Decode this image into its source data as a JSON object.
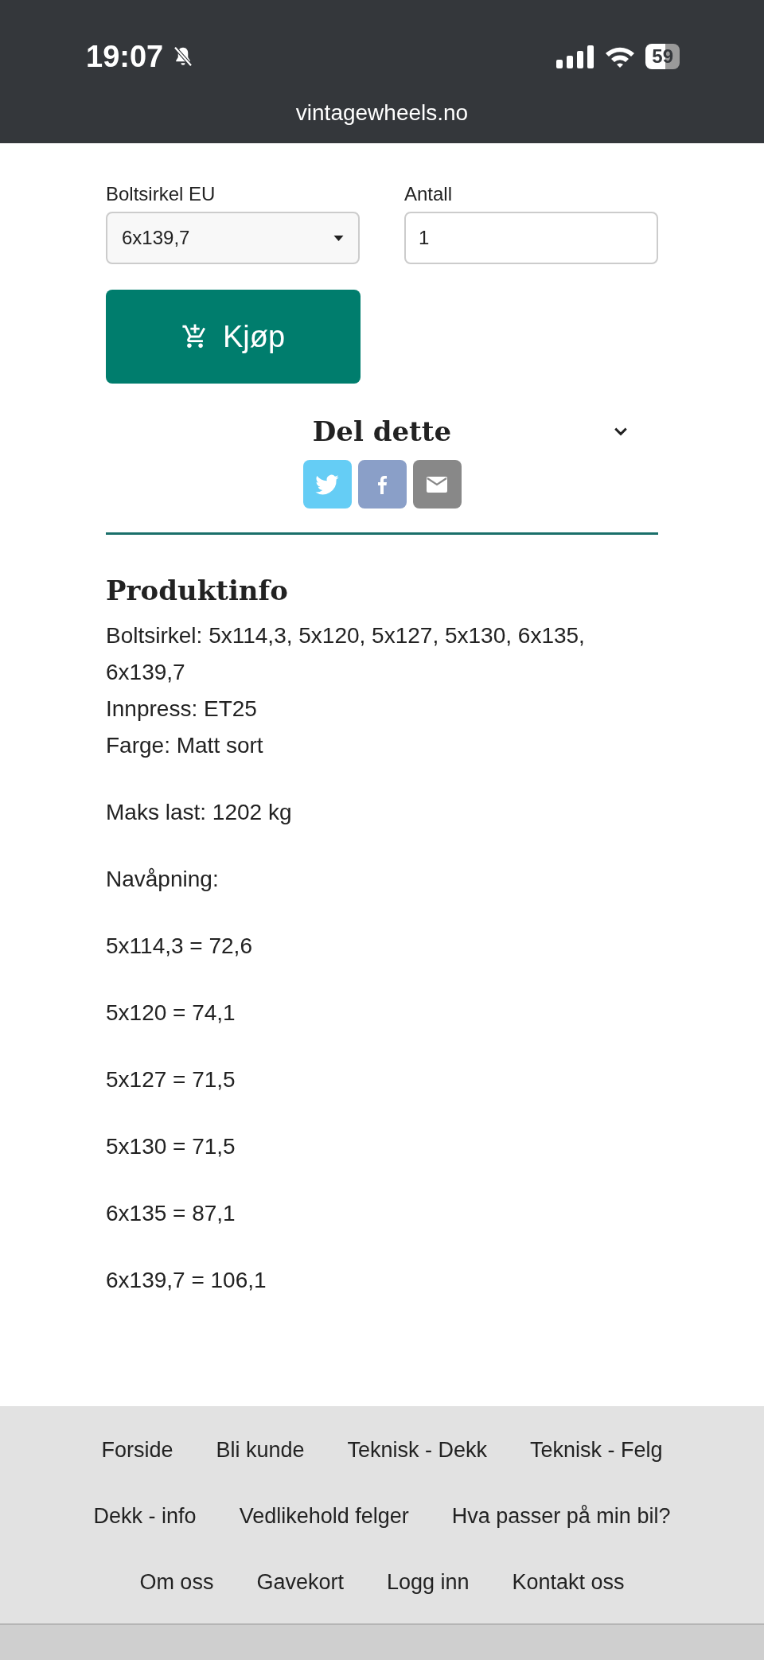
{
  "status_bar": {
    "time": "19:07",
    "silent": true,
    "battery": "59",
    "url": "vintagewheels.no"
  },
  "purchase": {
    "select": {
      "label": "Boltsirkel EU",
      "value": "6x139,7"
    },
    "quantity": {
      "label": "Antall",
      "value": "1"
    },
    "buy_button": "Kjøp"
  },
  "share": {
    "title": "Del dette",
    "buttons": [
      {
        "kind": "twitter"
      },
      {
        "kind": "facebook"
      },
      {
        "kind": "email"
      }
    ]
  },
  "product_info": {
    "title": "Produktinfo",
    "paragraphs": [
      [
        "Boltsirkel: 5x114,3, 5x120, 5x127, 5x130, 6x135, 6x139,7",
        "Innpress: ET25",
        "Farge: Matt sort"
      ],
      [
        "Maks last: 1202 kg"
      ],
      [
        "Navåpning:"
      ],
      [
        "5x114,3 = 72,6"
      ],
      [
        "5x120 = 74,1"
      ],
      [
        "5x127 = 71,5"
      ],
      [
        "5x130 = 71,5"
      ],
      [
        "6x135 = 87,1"
      ],
      [
        "6x139,7 = 106,1"
      ]
    ]
  },
  "footer": {
    "rows": [
      [
        "Forside",
        "Bli kunde",
        "Teknisk - Dekk",
        "Teknisk - Felg"
      ],
      [
        "Dekk - info",
        "Vedlikehold felger",
        "Hva passer på min bil?"
      ],
      [
        "Om oss",
        "Gavekort",
        "Logg inn",
        "Kontakt oss"
      ]
    ]
  }
}
